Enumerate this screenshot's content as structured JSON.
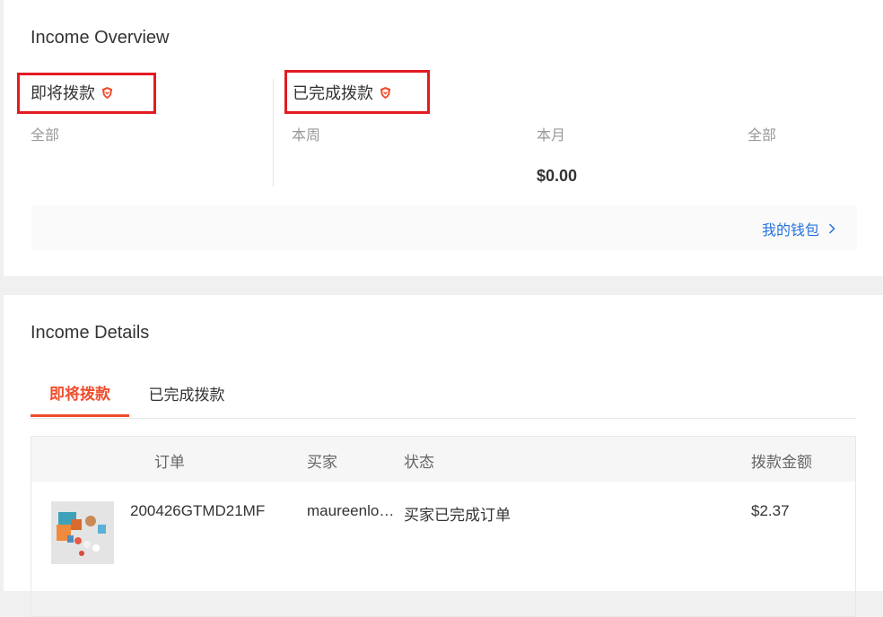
{
  "overview": {
    "title": "Income Overview",
    "upcoming": {
      "label": "即将拨款",
      "sub_all": "全部"
    },
    "completed": {
      "label": "已完成拨款",
      "sub_week": "本周",
      "sub_month": "本月",
      "sub_all": "全部",
      "month_amount": "$0.00"
    },
    "wallet_link": "我的钱包"
  },
  "details": {
    "title": "Income Details",
    "tabs": [
      {
        "label": "即将拨款",
        "active": true
      },
      {
        "label": "已完成拨款",
        "active": false
      }
    ],
    "columns": {
      "order": "订单",
      "buyer": "买家",
      "status": "状态",
      "amount": "拨款金额"
    },
    "rows": [
      {
        "order_id": "200426GTMD21MF",
        "buyer": "maureenlo…",
        "status": "买家已完成订单",
        "amount": "$2.37"
      }
    ]
  },
  "colors": {
    "accent": "#ee4d2d",
    "link": "#2673dd",
    "highlight": "#e31b23"
  }
}
